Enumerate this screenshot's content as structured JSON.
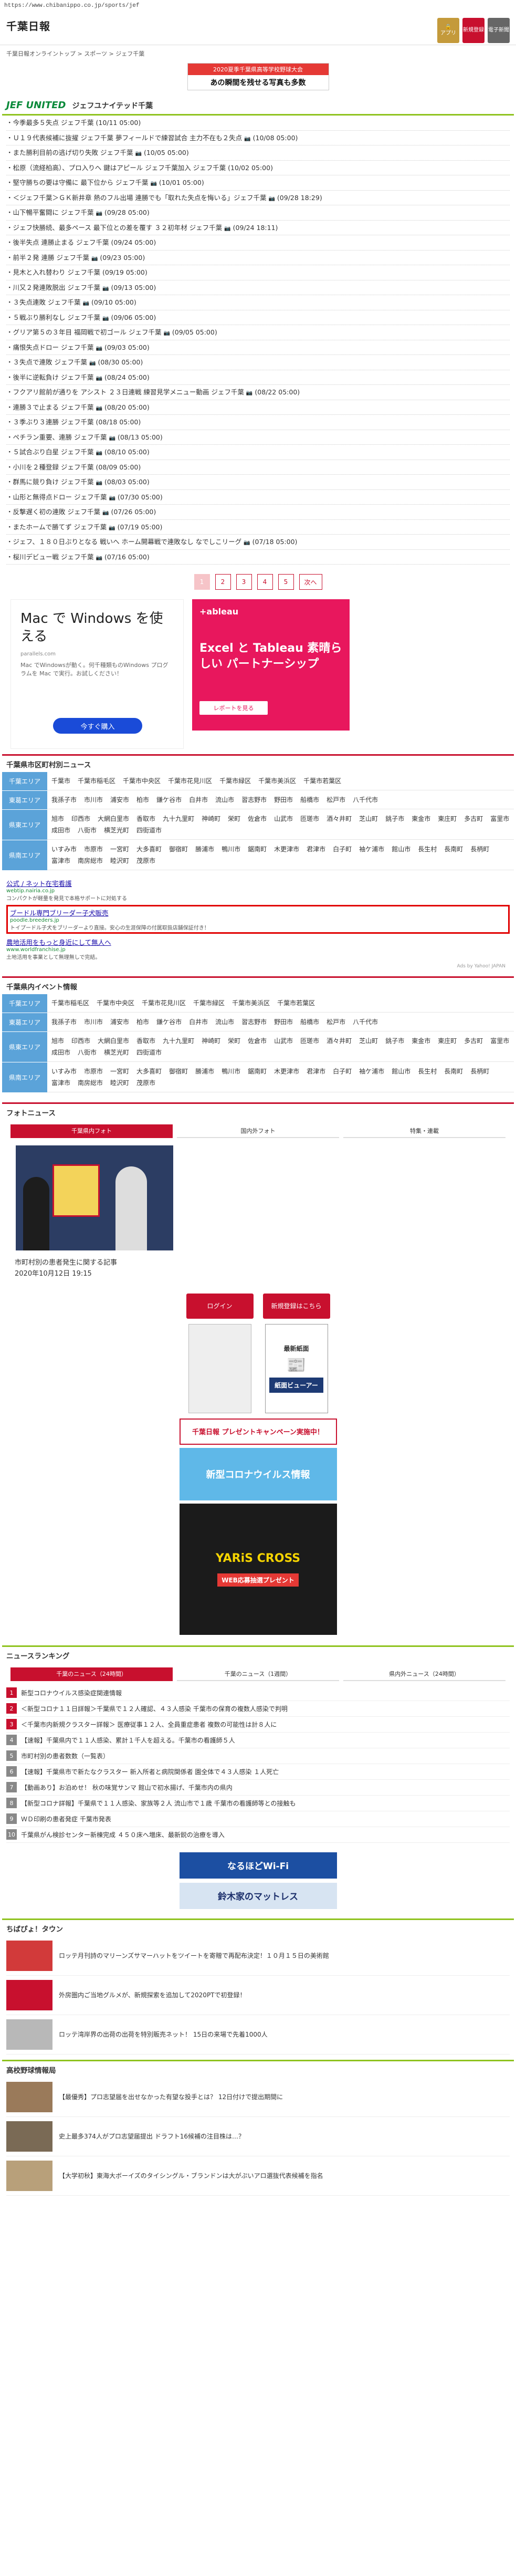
{
  "browser": {
    "url": "https://www.chibanippo.co.jp/sports/jef"
  },
  "header": {
    "logo": "千葉日報",
    "btn_app": "アプリ",
    "btn_register": "新規登録",
    "btn_epaper": "電子新聞"
  },
  "breadcrumb": "千葉日報オンライントップ > スポーツ > ジェフ千葉",
  "top_banner": {
    "line1": "2020夏季千葉県高等学校野球大会",
    "line2": "あの瞬間を残せる写真も多数"
  },
  "team": {
    "logo": "JEF UNITED",
    "name": "ジェフユナイテッド千葉"
  },
  "news": [
    {
      "title": "今季最多５失点 ジェフ千葉",
      "date": "(10/11 05:00)",
      "cam": false
    },
    {
      "title": "Ｕ１９代表候補に抜擢 ジェフ千葉 夢フィールドで練習試合 主力不在も２失点",
      "date": "(10/08 05:00)",
      "cam": true
    },
    {
      "title": "また勝利目前の逃げ切り失敗 ジェフ千葉",
      "date": "(10/05 05:00)",
      "cam": true
    },
    {
      "title": "松原（流経柏高）、プロ入りへ 鍵はアピール ジェフ千葉加入 ジェフ千葉",
      "date": "(10/02 05:00)",
      "cam": false
    },
    {
      "title": "堅守勝ちの要は守備に 最下位から ジェフ千葉",
      "date": "(10/01 05:00)",
      "cam": true
    },
    {
      "title": "＜ジェフ千葉＞ＧＫ新井章 熱のフル出場 連勝でも「取れた失点を悔いる」ジェフ千葉",
      "date": "(09/28 18:29)",
      "cam": true
    },
    {
      "title": "山下暢平奮闘に ジェフ千葉",
      "date": "(09/28 05:00)",
      "cam": true
    },
    {
      "title": "ジェフ快勝続、最多ペース 最下位との差を覆す ３２初年材 ジェフ千葉",
      "date": "(09/24 18:11)",
      "cam": true
    },
    {
      "title": "後半失点 連勝止まる ジェフ千葉",
      "date": "(09/24 05:00)",
      "cam": false
    },
    {
      "title": "前半２発 連勝 ジェフ千葉",
      "date": "(09/23 05:00)",
      "cam": true
    },
    {
      "title": "見木と入れ替わり ジェフ千葉",
      "date": "(09/19 05:00)",
      "cam": false
    },
    {
      "title": "川又２発連敗脱出 ジェフ千葉",
      "date": "(09/13 05:00)",
      "cam": true
    },
    {
      "title": "３失点連敗 ジェフ千葉",
      "date": "(09/10 05:00)",
      "cam": true
    },
    {
      "title": "５戦ぶり勝利なし ジェフ千葉",
      "date": "(09/06 05:00)",
      "cam": true
    },
    {
      "title": "グリア第５の３年目 福岡戦で初ゴール ジェフ千葉",
      "date": "(09/05 05:00)",
      "cam": true
    },
    {
      "title": "痛恨失点ドロー ジェフ千葉",
      "date": "(09/03 05:00)",
      "cam": true
    },
    {
      "title": "３失点で連敗 ジェフ千葉",
      "date": "(08/30 05:00)",
      "cam": true
    },
    {
      "title": "後半に逆転負け ジェフ千葉",
      "date": "(08/24 05:00)",
      "cam": true
    },
    {
      "title": "フクアリ館前が通りを アシスト ２３日連戦 練習見学メニュー動画 ジェフ千葉",
      "date": "(08/22 05:00)",
      "cam": true
    },
    {
      "title": "連勝３で止まる ジェフ千葉",
      "date": "(08/20 05:00)",
      "cam": true
    },
    {
      "title": "３季ぶり３連勝 ジェフ千葉",
      "date": "(08/18 05:00)",
      "cam": false
    },
    {
      "title": "ペチラン重要、連勝 ジェフ千葉",
      "date": "(08/13 05:00)",
      "cam": true
    },
    {
      "title": "５試合ぶり白星 ジェフ千葉",
      "date": "(08/10 05:00)",
      "cam": true
    },
    {
      "title": "小川を２種登録 ジェフ千葉",
      "date": "(08/09 05:00)",
      "cam": false
    },
    {
      "title": "群馬に競り負け ジェフ千葉",
      "date": "(08/03 05:00)",
      "cam": true
    },
    {
      "title": "山形と無得点ドロー ジェフ千葉",
      "date": "(07/30 05:00)",
      "cam": true
    },
    {
      "title": "反撃遅く初の連敗 ジェフ千葉",
      "date": "(07/26 05:00)",
      "cam": true
    },
    {
      "title": "またホームで勝てず ジェフ千葉",
      "date": "(07/19 05:00)",
      "cam": true
    },
    {
      "title": "ジェフ、１８０日ぶりとなる 戦いへ ホーム開幕戦で連敗なし なでしこリーグ",
      "date": "(07/18 05:00)",
      "cam": true
    },
    {
      "title": "桜川デビュー戦 ジェフ千葉",
      "date": "(07/16 05:00)",
      "cam": true
    }
  ],
  "pager": {
    "pages": [
      "1",
      "2",
      "3",
      "4",
      "5"
    ],
    "next": "次へ"
  },
  "ads": {
    "mac_title": "Mac で Windows を使える",
    "mac_src": "parallels.com",
    "mac_desc": "Mac でWindowsが動く。何千種類ものWindows プログラムを Mac で実行。お試しください！",
    "mac_btn": "今すぐ購入",
    "tab_logo": "+ableau",
    "tab_head": "Excel と Tableau 素晴らしい パートナーシップ",
    "tab_btn": "レポートを見る"
  },
  "city_news": {
    "title": "千葉県市区町村別ニュース",
    "rows": [
      {
        "area": "千葉エリア",
        "cities": [
          "千葉市",
          "千葉市稲毛区",
          "千葉市中央区",
          "千葉市花見川区",
          "千葉市緑区",
          "千葉市美浜区",
          "千葉市若葉区"
        ]
      },
      {
        "area": "東葛エリア",
        "cities": [
          "我孫子市",
          "市川市",
          "浦安市",
          "柏市",
          "鎌ケ谷市",
          "白井市",
          "流山市",
          "習志野市",
          "野田市",
          "船橋市",
          "松戸市",
          "八千代市"
        ]
      },
      {
        "area": "県東エリア",
        "cities": [
          "旭市",
          "印西市",
          "大網白里市",
          "香取市",
          "九十九里町",
          "神崎町",
          "栄町",
          "佐倉市",
          "山武市",
          "匝瑳市",
          "酒々井町",
          "芝山町",
          "銚子市",
          "東金市",
          "東庄町",
          "多古町",
          "富里市",
          "成田市",
          "八街市",
          "横芝光町",
          "四街道市"
        ]
      },
      {
        "area": "県南エリア",
        "cities": [
          "いすみ市",
          "市原市",
          "一宮町",
          "大多喜町",
          "御宿町",
          "勝浦市",
          "鴨川市",
          "鋸南町",
          "木更津市",
          "君津市",
          "白子町",
          "袖ケ浦市",
          "館山市",
          "長生村",
          "長南町",
          "長柄町",
          "富津市",
          "南房総市",
          "睦沢町",
          "茂原市"
        ]
      }
    ]
  },
  "text_ads": [
    {
      "title": "公式 / ネット在宅看護",
      "url": "webtip.nairia.co.jp",
      "desc": "コンパクトが軽量を発見で本格サポートに対処する",
      "hl": false
    },
    {
      "title": "ブードル専門ブリーダー子犬販売",
      "url": "poodle.breeders.jp",
      "desc": "トイプードル子犬をブリーダーより直接。安心の生涯保障の付属取扱店舗保証付き！",
      "hl": true
    },
    {
      "title": "農地活用をもっと身近にして無人へ",
      "url": "www.worldfranchise.jp",
      "desc": "土地活用を事業として無理無しで完結。",
      "hl": false
    }
  ],
  "adby": "Ads by Yahoo! JAPAN",
  "events": {
    "title": "千葉県内イベント情報",
    "rows": [
      {
        "area": "千葉エリア",
        "cities": [
          "千葉市稲毛区",
          "千葉市中央区",
          "千葉市花見川区",
          "千葉市緑区",
          "千葉市美浜区",
          "千葉市若葉区"
        ]
      },
      {
        "area": "東葛エリア",
        "cities": [
          "我孫子市",
          "市川市",
          "浦安市",
          "柏市",
          "鎌ケ谷市",
          "白井市",
          "流山市",
          "習志野市",
          "野田市",
          "船橋市",
          "松戸市",
          "八千代市"
        ]
      },
      {
        "area": "県東エリア",
        "cities": [
          "旭市",
          "印西市",
          "大網白里市",
          "香取市",
          "九十九里町",
          "神崎町",
          "栄町",
          "佐倉市",
          "山武市",
          "匝瑳市",
          "酒々井町",
          "芝山町",
          "銚子市",
          "東金市",
          "東庄町",
          "多古町",
          "富里市",
          "成田市",
          "八街市",
          "横芝光町",
          "四街道市"
        ]
      },
      {
        "area": "県南エリア",
        "cities": [
          "いすみ市",
          "市原市",
          "一宮町",
          "大多喜町",
          "御宿町",
          "勝浦市",
          "鴨川市",
          "鋸南町",
          "木更津市",
          "君津市",
          "白子町",
          "袖ケ浦市",
          "館山市",
          "長生村",
          "長南町",
          "長柄町",
          "富津市",
          "南房総市",
          "睦沢町",
          "茂原市"
        ]
      }
    ]
  },
  "photo_news": {
    "title": "フォトニュース",
    "tabs": [
      "千葉県内フォト",
      "国内外フォト",
      "特集・連載"
    ],
    "caption": "市町村別の患者発生に関する記事",
    "date": "2020年10月12日 19:15"
  },
  "side": {
    "login": "ログイン",
    "register": "新規登録はこちら",
    "viewer": "紙面ビューアー",
    "viewer_new": "最新紙面",
    "ban_campaign": "千葉日報 プレゼントキャンペーン実施中！",
    "ban_corona": "新型コロナウイルス情報",
    "ban_car_title": "YARiS CROSS",
    "ban_car_sub": "WEB応募抽選プレゼント"
  },
  "ranking": {
    "title": "ニュースランキング",
    "tabs": [
      "千葉のニュース（24時間）",
      "千葉のニュース（1週間）",
      "県内外ニュース（24時間）"
    ],
    "items": [
      {
        "n": "1",
        "t": "新型コロナウイルス感染症関連情報"
      },
      {
        "n": "2",
        "t": "＜新型コロナ１１日詳報＞千葉県で１２人確認、４３人感染 千葉市の保育の複数人感染で判明"
      },
      {
        "n": "3",
        "t": "＜千葉市内新規クラスター詳報＞ 医療従事１２人、全員重症患者 複数の可能性は計８人に"
      },
      {
        "n": "4",
        "t": "【速報】千葉県内で１１人感染、累計１千人を超える。千葉市の看護師５人"
      },
      {
        "n": "5",
        "t": "市町村別の患者数数（一覧表）"
      },
      {
        "n": "6",
        "t": "【速報】千葉県市で新たなクラスター 新入所者と病院関係者 園全体で４３人感染 １人死亡"
      },
      {
        "n": "7",
        "t": "【動画あり】お泊めせ！ 秋の味覚サンマ 館山で初水揚げ、千葉市内の県内"
      },
      {
        "n": "8",
        "t": "【新型コロナ詳報】千葉県で１１人感染、家族等２人 流山市で１歳 千葉市の看護師等との接触も"
      },
      {
        "n": "9",
        "t": "ＷＤ印刷の患者発症 千葉市発表"
      },
      {
        "n": "10",
        "t": "千葉県がん検診センター新棟完成 ４５０床へ増床、最新鋭の治療を導入"
      }
    ]
  },
  "bans2": {
    "wifi": "なるほどWi-Fi",
    "mat": "鈴木家のマットレス"
  },
  "chibapi": {
    "title": "ちばぴょ！タウン",
    "items": [
      "ロッテ月刊詩のマリーンズサマーハットをツイートを寄贈で再配布決定！１０月１５日の美術館",
      "外房圏内ご当地グルメが、新規探索を追加して2020PTで初登録！",
      "ロッテ湾岸界の出荷の出荷を特別販売ネット！ 15日の来場で先着1000人"
    ]
  },
  "koko": {
    "title": "高校野球情報局",
    "items": [
      "【最優秀】プロ志望届を出せなかった有望な投手とは？ 12日付けで提出期間に",
      "史上最多374人がプロ志望届提出 ドラフト16候補の注目株は…？",
      "【大学初秋】東海大ボーイズのタイシングル・ブランドンは大がぷいアロ選抜代表候補を指名"
    ]
  }
}
